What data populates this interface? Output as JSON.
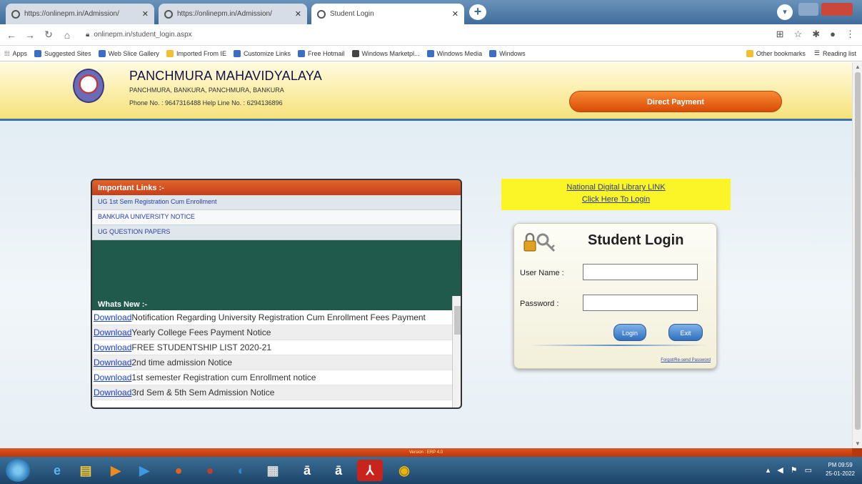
{
  "browser": {
    "tabs": [
      {
        "title": "https://onlinepm.in/Admission/"
      },
      {
        "title": "https://onlinepm.in/Admission/"
      },
      {
        "title": "Student Login"
      }
    ],
    "url": "onlinepm.in/student_login.aspx",
    "bookmarks": [
      "Apps",
      "Suggested Sites",
      "Web Slice Gallery",
      "Imported From IE",
      "Customize Links",
      "Free Hotmail",
      "Windows Marketpl...",
      "Windows Media",
      "Windows"
    ],
    "bookmarks_right": [
      "Other bookmarks",
      "Reading list"
    ]
  },
  "header": {
    "college_name": "PANCHMURA MAHAVIDYALAYA",
    "address": "PANCHMURA, BANKURA, PANCHMURA, BANKURA",
    "phone": "Phone No. : 9647316488   Help Line No. : 6294136896",
    "direct_payment": "Direct Payment"
  },
  "important_links": {
    "heading": "Important Links :-",
    "items": [
      "UG 1st Sem Registration Cum Enrollment",
      "BANKURA UNIVERSITY NOTICE",
      "UG QUESTION PAPERS"
    ]
  },
  "whats_new": {
    "heading": "Whats New :-",
    "link_label": "Download",
    "items": [
      "Notification Regarding University Registration Cum Enrollment Fees Payment",
      "Yearly College Fees Payment Notice",
      "FREE STUDENTSHIP LIST 2020-21",
      "2nd time admission Notice",
      "1st semester Registration cum Enrollment notice",
      "3rd Sem & 5th Sem Admission Notice"
    ]
  },
  "ndl": {
    "line1": "National Digital Library LINK",
    "line2": "Click Here To Login"
  },
  "login": {
    "title": "Student Login",
    "username_label": "User Name :",
    "password_label": "Password :",
    "login_button": "Login",
    "exit_button": "Exit",
    "forgot": "Forgot/Re-send Password"
  },
  "footer": {
    "version": "Version : ERP 4.0"
  },
  "taskbar": {
    "time": "PM 09:59",
    "date": "25-01-2022"
  }
}
